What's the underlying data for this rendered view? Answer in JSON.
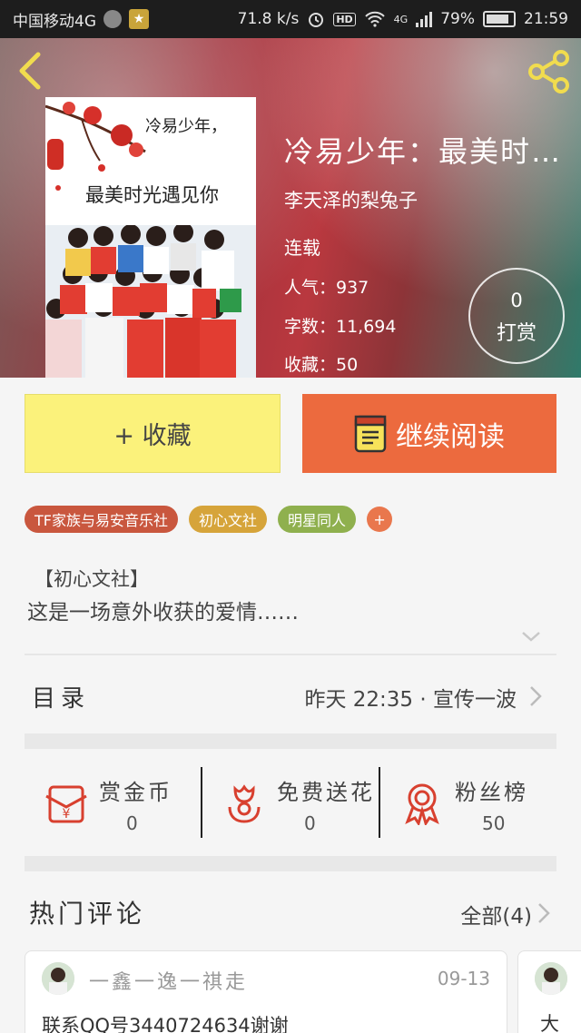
{
  "status_bar": {
    "carrier": "中国移动4G",
    "speed": "71.8 k/s",
    "hd": "HD",
    "network": "4G",
    "battery": "79%",
    "time": "21:59"
  },
  "book": {
    "title": "冷易少年：最美时…",
    "author": "李天泽的梨兔子",
    "status": "连载",
    "popularity": "人气：937",
    "word_count": "字数：11,694",
    "favorites": "收藏：50",
    "cover_line1": "冷易少年，",
    "cover_line2": "最美时光遇见你"
  },
  "tip": {
    "count": "0",
    "label": "打赏"
  },
  "actions": {
    "favorite_label": "+ 收藏",
    "read_label": "继续阅读"
  },
  "tags": [
    {
      "label": "TF家族与易安音乐社",
      "color": "#c9573e"
    },
    {
      "label": "初心文社",
      "color": "#d6a43a"
    },
    {
      "label": "明星同人",
      "color": "#8fb04e"
    }
  ],
  "tag_more": "+",
  "intro": {
    "line1": "【初心文社】",
    "line2": "这是一场意外收获的爱情……"
  },
  "catalog": {
    "label": "目录",
    "latest": "昨天 22:35 · 宣传一波"
  },
  "stats": [
    {
      "label": "赏金币",
      "value": "0",
      "icon": "gold-coin-icon"
    },
    {
      "label": "免费送花",
      "value": "0",
      "icon": "flower-icon"
    },
    {
      "label": "粉丝榜",
      "value": "50",
      "icon": "medal-icon"
    }
  ],
  "hot_comments": {
    "title": "热门评论",
    "all_label": "全部(4)",
    "items": [
      {
        "user": "一鑫一逸一祺走",
        "date": "09-13",
        "text": "联系QQ号3440724634谢谢"
      },
      {
        "text": "大"
      }
    ]
  },
  "colors": {
    "accent": "#ec6a3e",
    "favorite": "#fbf27b",
    "icon_red": "#d8402f"
  }
}
